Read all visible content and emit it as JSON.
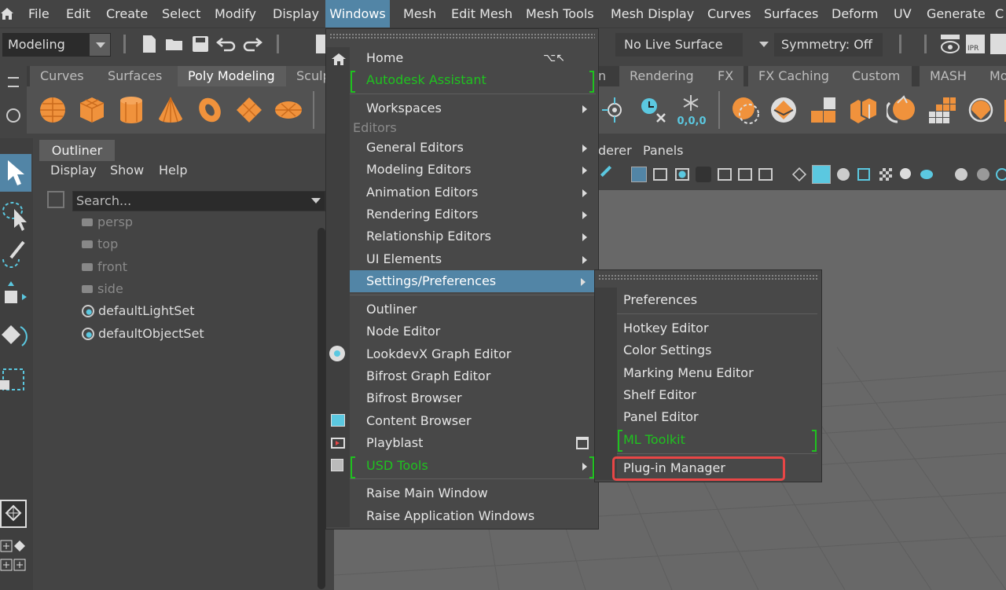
{
  "menubar": {
    "items": [
      "File",
      "Edit",
      "Create",
      "Select",
      "Modify",
      "Display",
      "Windows",
      "Mesh",
      "Edit Mesh",
      "Mesh Tools",
      "Mesh Display",
      "Curves",
      "Surfaces",
      "Deform",
      "UV",
      "Generate",
      "C"
    ],
    "active_index": 6
  },
  "statusline": {
    "mode": "Modeling",
    "live_surface": "No Live Surface",
    "symmetry": "Symmetry: Off"
  },
  "shelf": {
    "tabs": [
      "Curves",
      "Surfaces",
      "Poly Modeling",
      "Sculp",
      "Rendering",
      "FX",
      "FX Caching",
      "Custom",
      "MASH",
      "Mo"
    ],
    "active_tab": "Poly Modeling",
    "hidden_tab_suffix": "n",
    "snow_label": "0,0,0"
  },
  "outliner": {
    "tab": "Outliner",
    "menu": [
      "Display",
      "Show",
      "Help"
    ],
    "search_placeholder": "Search...",
    "items": [
      "persp",
      "top",
      "front",
      "side",
      "defaultLightSet",
      "defaultObjectSet"
    ]
  },
  "viewport": {
    "menu_partial": "derer",
    "panels": "Panels"
  },
  "windows_menu": {
    "home": "Home",
    "home_shortcut": "⌥↖",
    "assistant": "Autodesk Assistant",
    "workspaces": "Workspaces",
    "editors_header": "Editors",
    "editors": [
      "General Editors",
      "Modeling Editors",
      "Animation Editors",
      "Rendering Editors",
      "Relationship Editors",
      "UI Elements",
      "Settings/Preferences"
    ],
    "windows": [
      "Outliner",
      "Node Editor",
      "LookdevX Graph Editor",
      "Bifrost Graph Editor",
      "Bifrost Browser",
      "Content Browser",
      "Playblast"
    ],
    "usd_tools": "USD Tools",
    "bottom": [
      "Raise Main Window",
      "Raise Application Windows"
    ]
  },
  "settings_submenu": {
    "preferences": "Preferences",
    "items": [
      "Hotkey Editor",
      "Color Settings",
      "Marking Menu Editor",
      "Shelf Editor",
      "Panel Editor"
    ],
    "ml_toolkit": "ML Toolkit",
    "plugin_manager": "Plug-in Manager",
    "highlight_color": "#e84646"
  },
  "colors": {
    "accent": "#5285a6",
    "green": "#1fc21f",
    "orange": "#f0923c"
  }
}
